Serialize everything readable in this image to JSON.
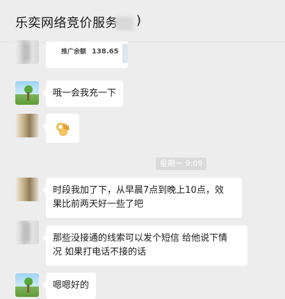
{
  "header": {
    "title": "乐奕网络竞价服务",
    "title_suffix": ")"
  },
  "messages": {
    "card": {
      "label": "推广余额",
      "value": "138.65"
    },
    "m1": "哦一会我充一下",
    "m2_icon": "ok-hand-emoji",
    "timestamp": "星期一 9:09",
    "m3_line1": "时段我加了下，从早晨7点到晚上10点，效",
    "m3_line2": "果比前两天好一些了吧",
    "m4_line1": "那些没接通的线索可以发个短信 给他说下情",
    "m4_line2": "况 如果打电话不接的话",
    "m5": "嗯嗯好的"
  },
  "colors": {
    "chat_bg": "#ededed",
    "bubble_bg": "#ffffff",
    "time_badge_bg": "#dadada"
  }
}
